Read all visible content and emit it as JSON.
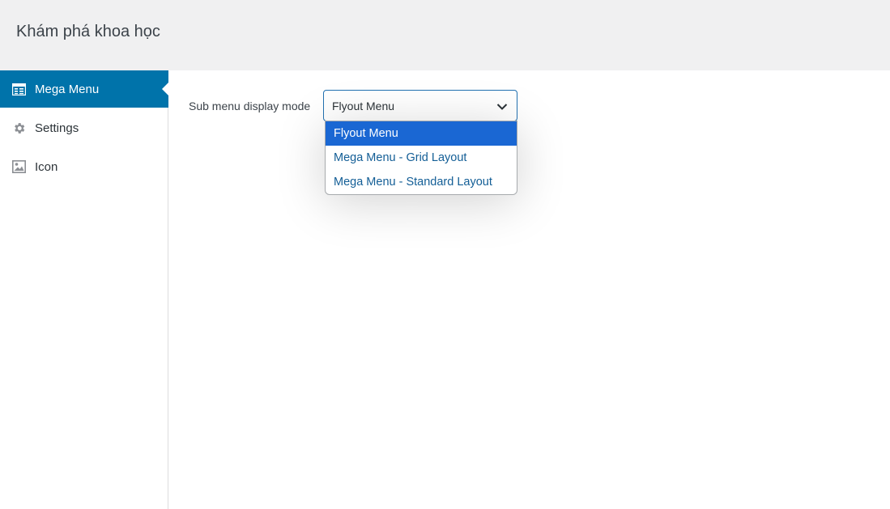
{
  "header": {
    "title": "Khám phá khoa học"
  },
  "sidebar": {
    "items": [
      {
        "label": "Mega Menu",
        "icon": "mega-menu-icon",
        "active": true
      },
      {
        "label": "Settings",
        "icon": "gear-icon",
        "active": false
      },
      {
        "label": "Icon",
        "icon": "image-icon",
        "active": false
      }
    ]
  },
  "main": {
    "field": {
      "label": "Sub menu display mode",
      "value": "Flyout Menu",
      "options": [
        "Flyout Menu",
        "Mega Menu - Grid Layout",
        "Mega Menu - Standard Layout"
      ],
      "selected_index": 0
    }
  },
  "colors": {
    "accent": "#0073aa",
    "selected_option": "#1a67d3",
    "link": "#135e96",
    "header_bg": "#f0f0f1"
  }
}
